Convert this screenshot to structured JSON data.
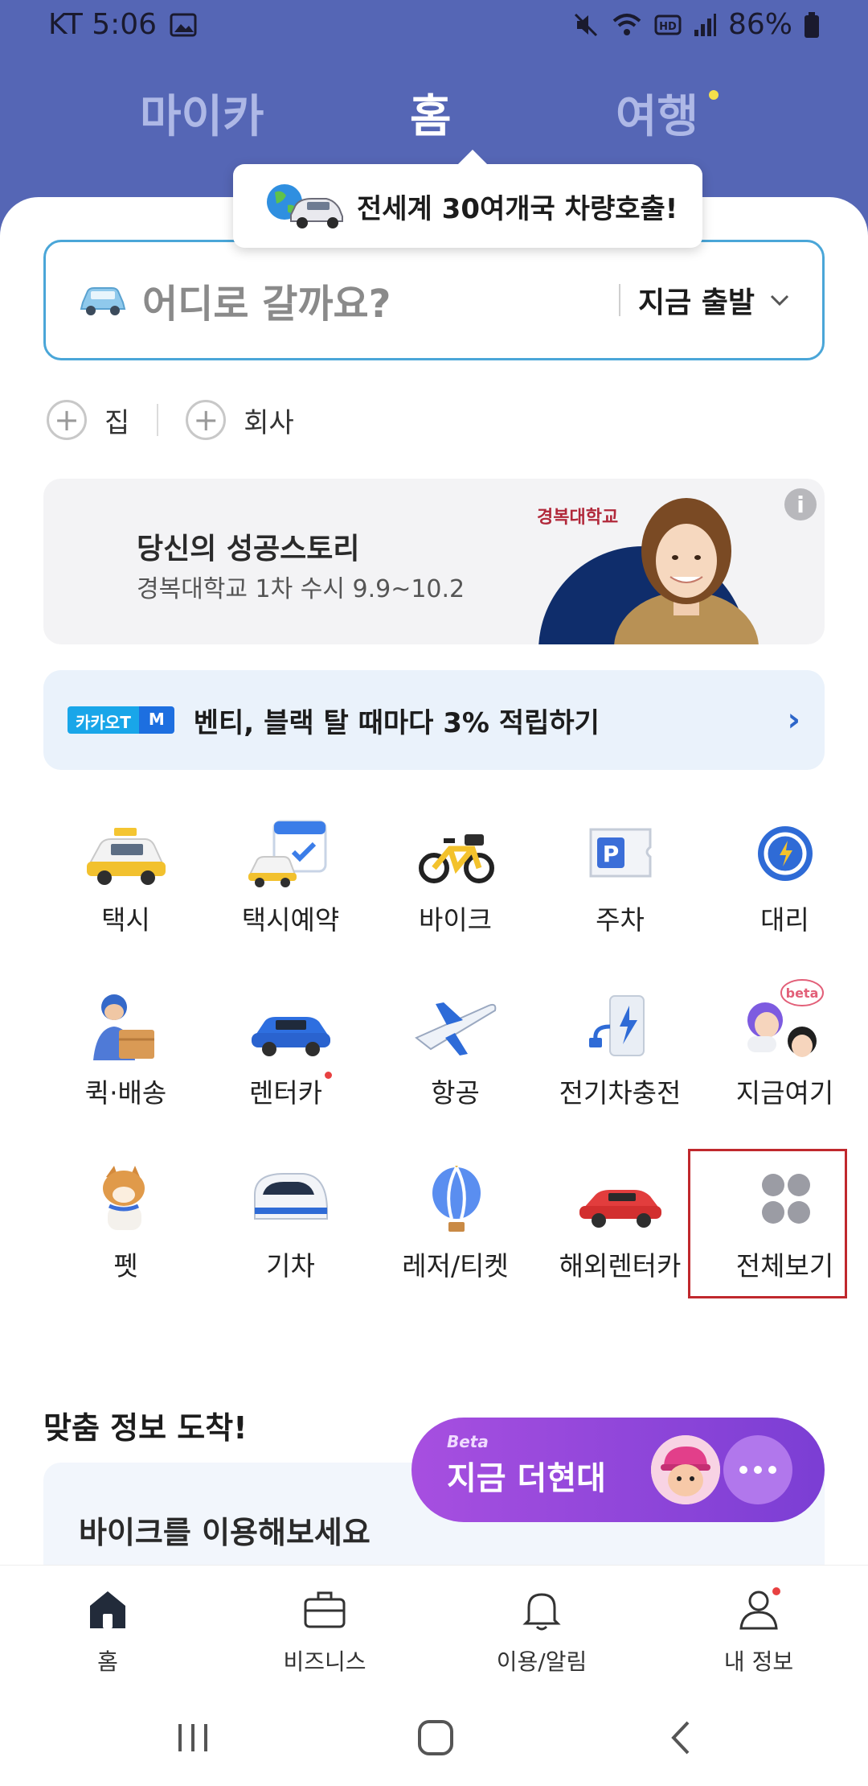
{
  "status_bar": {
    "carrier_time": "KT 5:06",
    "battery": "86%"
  },
  "tabs": [
    {
      "label": "마이카",
      "active": false
    },
    {
      "label": "홈",
      "active": true
    },
    {
      "label": "여행",
      "active": false
    }
  ],
  "tooltip": {
    "text": "전세계 30여개국 차량호출!"
  },
  "search": {
    "placeholder": "어디로 갈까요?",
    "depart_label": "지금 출발"
  },
  "quick_places": [
    {
      "label": "집"
    },
    {
      "label": "회사"
    }
  ],
  "banner": {
    "title": "당신의 성공스토리",
    "subtitle": "경복대학교 1차 수시 9.9~10.2",
    "logo_text": "경복대학교",
    "info_icon": "info-icon"
  },
  "promo": {
    "badge_left": "카카오T",
    "badge_right": "M",
    "text": "벤티, 블랙 탈 때마다 3% 적립하기"
  },
  "services": [
    {
      "label": "택시",
      "icon": "taxi-icon"
    },
    {
      "label": "택시예약",
      "icon": "taxi-reservation-icon"
    },
    {
      "label": "바이크",
      "icon": "bike-icon"
    },
    {
      "label": "주차",
      "icon": "parking-icon"
    },
    {
      "label": "대리",
      "icon": "chauffeur-icon"
    },
    {
      "label": "퀵·배송",
      "icon": "delivery-icon"
    },
    {
      "label": "렌터카",
      "icon": "rental-car-icon",
      "dot": true
    },
    {
      "label": "항공",
      "icon": "airplane-icon"
    },
    {
      "label": "전기차충전",
      "icon": "ev-charging-icon"
    },
    {
      "label": "지금여기",
      "icon": "now-here-icon"
    },
    {
      "label": "펫",
      "icon": "pet-icon"
    },
    {
      "label": "기차",
      "icon": "train-icon"
    },
    {
      "label": "레저/티켓",
      "icon": "leisure-ticket-icon"
    },
    {
      "label": "해외렌터카",
      "icon": "overseas-rental-icon"
    },
    {
      "label": "전체보기",
      "icon": "view-all-icon"
    }
  ],
  "now_here_badge": "beta",
  "section": {
    "title": "맞춤 정보 도착!",
    "card_title": "바이크를 이용해보세요"
  },
  "fab": {
    "beta": "Beta",
    "text": "지금 더현대"
  },
  "bottom_nav": [
    {
      "label": "홈",
      "icon": "home-icon",
      "active": true
    },
    {
      "label": "비즈니스",
      "icon": "briefcase-icon",
      "active": false
    },
    {
      "label": "이용/알림",
      "icon": "bell-icon",
      "active": false
    },
    {
      "label": "내 정보",
      "icon": "profile-icon",
      "active": false,
      "dot": true
    }
  ],
  "colors": {
    "header": "#5566b5",
    "accent": "#4aa6d8",
    "fab_start": "#a74fe0",
    "fab_end": "#7b3ed4",
    "highlight": "#c0282d"
  }
}
